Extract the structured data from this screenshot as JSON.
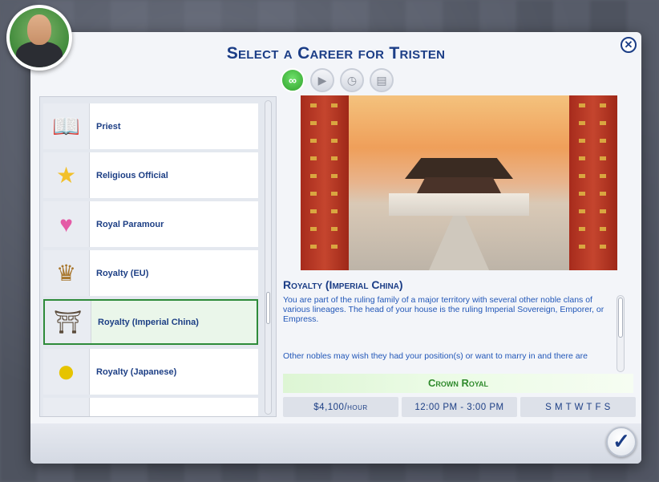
{
  "title": "Select a Career for Tristen",
  "filters": [
    {
      "name": "all-careers-filter",
      "icon": "infinity-icon",
      "glyph": "∞",
      "active": true
    },
    {
      "name": "active-careers-filter",
      "icon": "briefcase-play-icon",
      "glyph": "▶",
      "active": false
    },
    {
      "name": "part-time-filter",
      "icon": "briefcase-clock-icon",
      "glyph": "◷",
      "active": false
    },
    {
      "name": "freelance-filter",
      "icon": "briefcase-stack-icon",
      "glyph": "▤",
      "active": false
    }
  ],
  "careers": [
    {
      "label": "Priest",
      "icon": "book-star-icon",
      "glyph": "📖"
    },
    {
      "label": "Religious Official",
      "icon": "shooting-star-icon",
      "glyph": "★"
    },
    {
      "label": "Royal Paramour",
      "icon": "hearts-icon",
      "glyph": "♥"
    },
    {
      "label": "Royalty (EU)",
      "icon": "crown-icon",
      "glyph": "♛"
    },
    {
      "label": "Royalty (Imperial China)",
      "icon": "palace-icon",
      "glyph": "⛩"
    },
    {
      "label": "Royalty (Japanese)",
      "icon": "gold-sun-icon",
      "glyph": "●"
    },
    {
      "label": "",
      "icon": "partial-item-icon",
      "glyph": "◐"
    }
  ],
  "selected_index": 4,
  "detail": {
    "name": "Royalty (Imperial China)",
    "description_1": "You are part of the ruling family of a major territory with several other noble clans of various lineages. The head of your house is the ruling Imperial Sovereign, Emporer, or Empress.",
    "description_2": "Other nobles may wish they had your position(s) or want to marry in and there are",
    "branch": "Crown Royal",
    "pay": "$4,100/hour",
    "hours": "12:00 PM - 3:00 PM",
    "days": "S M T W T F S"
  },
  "colors": {
    "title": "#1b3d86",
    "accent_green": "#2f8a2c",
    "description": "#2257b8"
  }
}
